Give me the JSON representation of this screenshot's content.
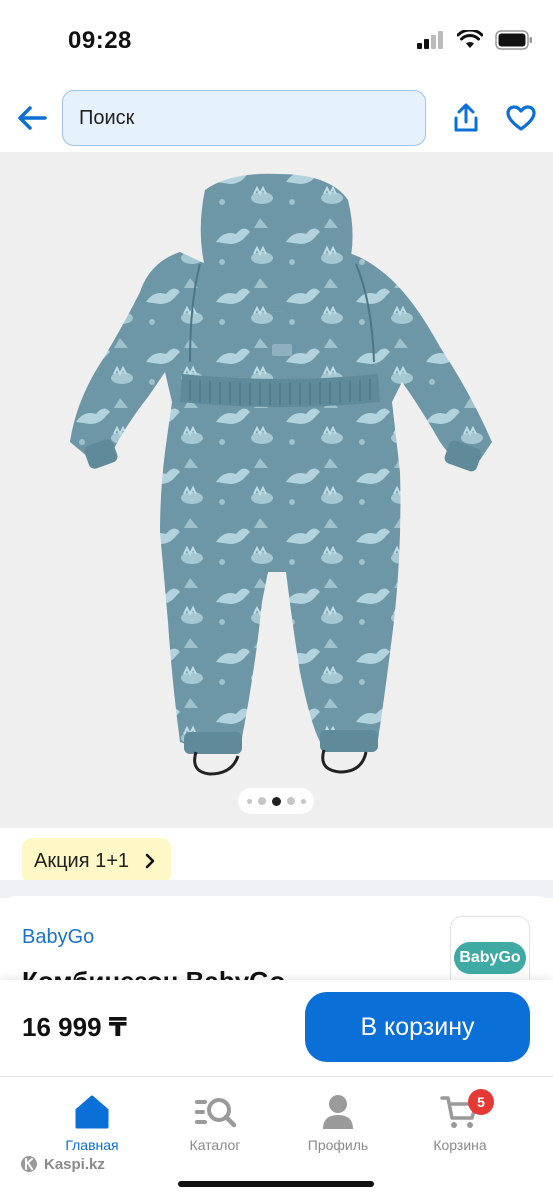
{
  "status_bar": {
    "time": "09:28"
  },
  "header": {
    "search_placeholder": "Поиск"
  },
  "gallery": {
    "image_count": 5,
    "active_index": 2,
    "product_color": "#6d96a6",
    "print_color": "#bfdde6"
  },
  "promo": {
    "label": "Акция 1+1"
  },
  "product": {
    "brand": "BabyGo",
    "title": "Комбинезон BabyGo",
    "brand_logo_text": "BabyGo"
  },
  "purchase": {
    "price": "16 999 ₸",
    "cart_button": "В корзину"
  },
  "tabs": [
    {
      "label": "Главная",
      "icon": "home-icon",
      "active": true
    },
    {
      "label": "Каталог",
      "icon": "catalog-search-icon",
      "active": false
    },
    {
      "label": "Профиль",
      "icon": "profile-icon",
      "active": false
    },
    {
      "label": "Корзина",
      "icon": "cart-icon",
      "active": false,
      "badge": "5"
    }
  ],
  "footer": {
    "domain": "Kaspi.kz"
  },
  "colors": {
    "accent": "#0a6fd6",
    "search_bg": "#e6f2fb",
    "promo_bg": "#fdf8c6",
    "badge": "#e53935"
  }
}
